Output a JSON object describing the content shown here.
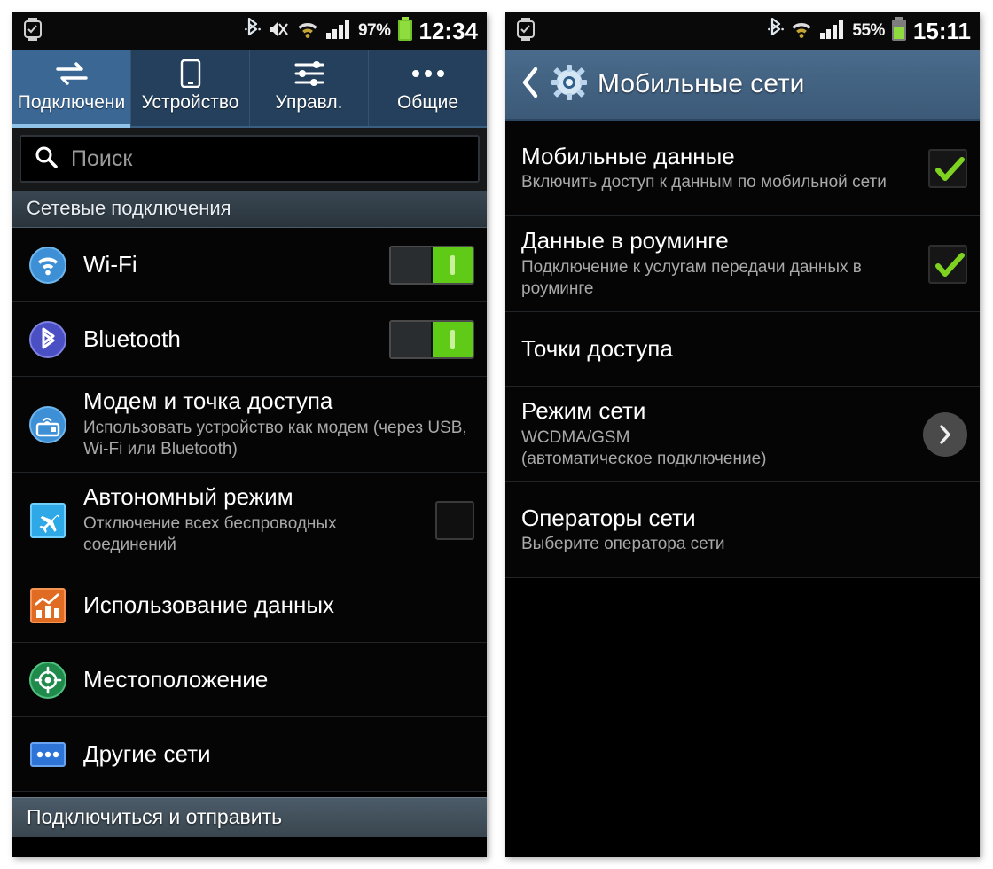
{
  "left_phone": {
    "statusbar": {
      "watch_icon": "watch-icon",
      "icons": [
        "bluetooth-icon",
        "mute-vibrate-icon",
        "wifi-icon",
        "signal-bars-icon"
      ],
      "battery_pct": "97%",
      "battery_icon": "battery-icon",
      "clock": "12:34"
    },
    "tabs": [
      {
        "label": "Подключени",
        "icon": "connections-arrows-icon",
        "active": true
      },
      {
        "label": "Устройство",
        "icon": "device-phone-icon",
        "active": false
      },
      {
        "label": "Управл.",
        "icon": "sliders-icon",
        "active": false
      },
      {
        "label": "Общие",
        "icon": "more-dots-icon",
        "active": false
      }
    ],
    "search": {
      "placeholder": "Поиск",
      "icon": "search-icon"
    },
    "section_header": "Сетевые подключения",
    "rows": [
      {
        "icon": "wifi-icon",
        "title": "Wi-Fi",
        "sub": "",
        "control": "toggle-on"
      },
      {
        "icon": "bluetooth-icon",
        "title": "Bluetooth",
        "sub": "",
        "control": "toggle-on"
      },
      {
        "icon": "tethering-icon",
        "title": "Модем и точка доступа",
        "sub": "Использовать устройство как модем (через USB, Wi-Fi или Bluetooth)",
        "control": "none"
      },
      {
        "icon": "airplane-icon",
        "title": "Автономный режим",
        "sub": "Отключение всех беспроводных соединений",
        "control": "checkbox-off"
      },
      {
        "icon": "data-usage-icon",
        "title": "Использование данных",
        "sub": "",
        "control": "none"
      },
      {
        "icon": "location-icon",
        "title": "Местоположение",
        "sub": "",
        "control": "none"
      },
      {
        "icon": "other-networks-icon",
        "title": "Другие сети",
        "sub": "",
        "control": "none"
      }
    ],
    "bottom_bar": "Подключиться и отправить"
  },
  "right_phone": {
    "statusbar": {
      "watch_icon": "watch-icon",
      "icons": [
        "bluetooth-icon",
        "wifi-icon",
        "signal-bars-icon"
      ],
      "battery_pct": "55%",
      "battery_icon": "battery-icon",
      "clock": "15:11"
    },
    "actionbar": {
      "back_icon": "back-chevron-icon",
      "app_icon": "gear-icon",
      "title": "Мобильные сети"
    },
    "rows": [
      {
        "title": "Мобильные данные",
        "sub": "Включить доступ к данным по мобильной сети",
        "control": "checkbox-checked"
      },
      {
        "title": "Данные в роуминге",
        "sub": "Подключение к услугам передачи данных в роуминге",
        "control": "checkbox-checked"
      },
      {
        "title": "Точки доступа",
        "sub": "",
        "control": "none"
      },
      {
        "title": "Режим сети",
        "sub": "WCDMA/GSM\n(автоматическое подключение)",
        "control": "chevron"
      },
      {
        "title": "Операторы сети",
        "sub": "Выберите оператора сети",
        "control": "none"
      }
    ]
  },
  "colors": {
    "accent_blue": "#3b6794",
    "actionbar_blue": "#4a6b8c",
    "toggle_green": "#5fcb16",
    "check_green": "#7ed321",
    "page_bg": "#ffffff",
    "list_bg": "#050505"
  }
}
